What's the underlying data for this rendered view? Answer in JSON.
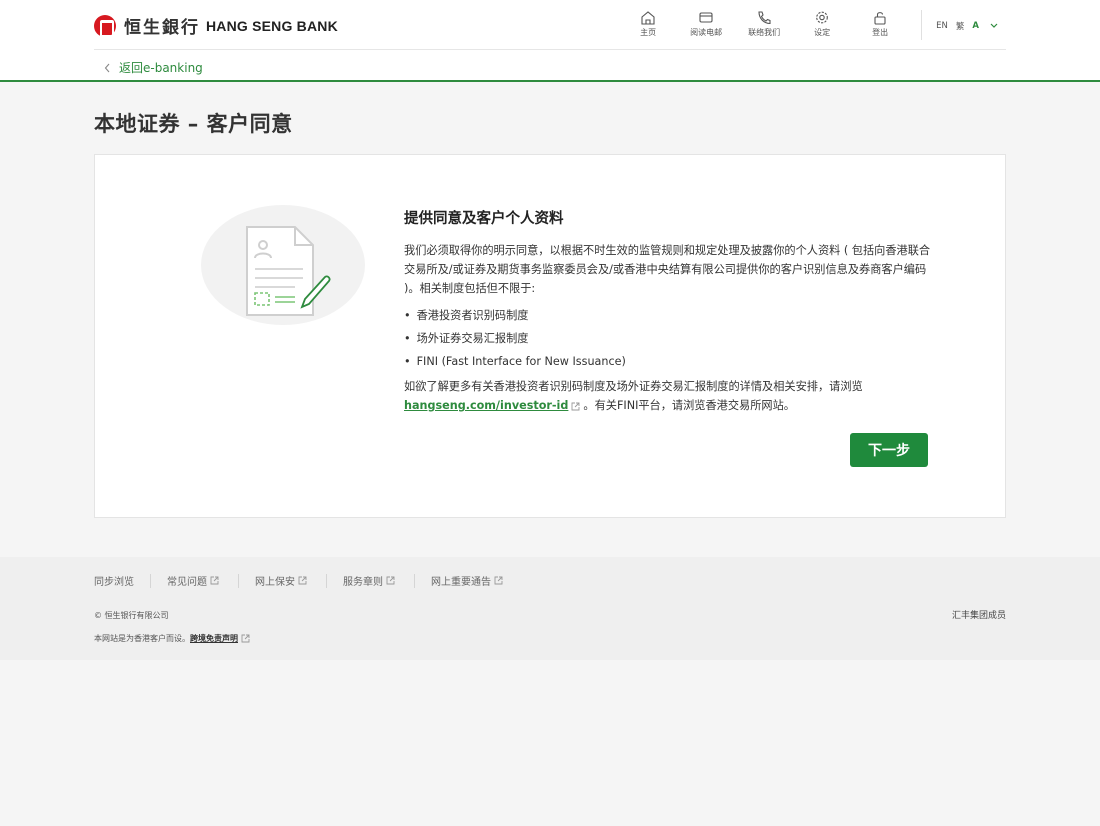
{
  "header": {
    "brand_cn": "恒生銀行",
    "brand_en": "HANG SENG BANK",
    "nav": [
      {
        "label": "主页",
        "icon": "home-icon"
      },
      {
        "label": "阅读电邮",
        "icon": "mail-icon"
      },
      {
        "label": "联络我们",
        "icon": "phone-icon"
      },
      {
        "label": "设定",
        "icon": "gear-icon"
      },
      {
        "label": "登出",
        "icon": "unlock-icon"
      }
    ],
    "lang": {
      "en": "EN",
      "tc": "繁",
      "font": "A"
    }
  },
  "back_label": "返回e-banking",
  "page_title": "本地证券 – 客户同意",
  "content": {
    "heading": "提供同意及客户个人资料",
    "intro": "我们必须取得你的明示同意，以根据不时生效的监管规则和规定处理及披露你的个人资料 ( 包括向香港联合交易所及/或证券及期货事务监察委员会及/或香港中央结算有限公司提供你的客户识别信息及券商客户编码 )。相关制度包括但不限于:",
    "bullets": [
      "香港投资者识别码制度",
      "场外证券交易汇报制度",
      "FINI (Fast Interface for New Issuance)"
    ],
    "more_prefix": "如欲了解更多有关香港投资者识别码制度及场外证券交易汇报制度的详情及相关安排，请浏览",
    "more_link": "hangseng.com/investor-id",
    "more_suffix": "。有关FINI平台，请浏览香港交易所网站。",
    "next_button": "下一步"
  },
  "footer": {
    "links": [
      "同步浏览",
      "常见问题",
      "网上保安",
      "服务章则",
      "网上重要通告"
    ],
    "copyright": "© 恒生银行有限公司",
    "disclaimer_prefix": "本网站是为香港客户而设。",
    "disclaimer_link": "跨境免责声明",
    "member": "汇丰集团成员"
  },
  "colors": {
    "accent": "#1f8a3c",
    "brand_red": "#d71920"
  }
}
